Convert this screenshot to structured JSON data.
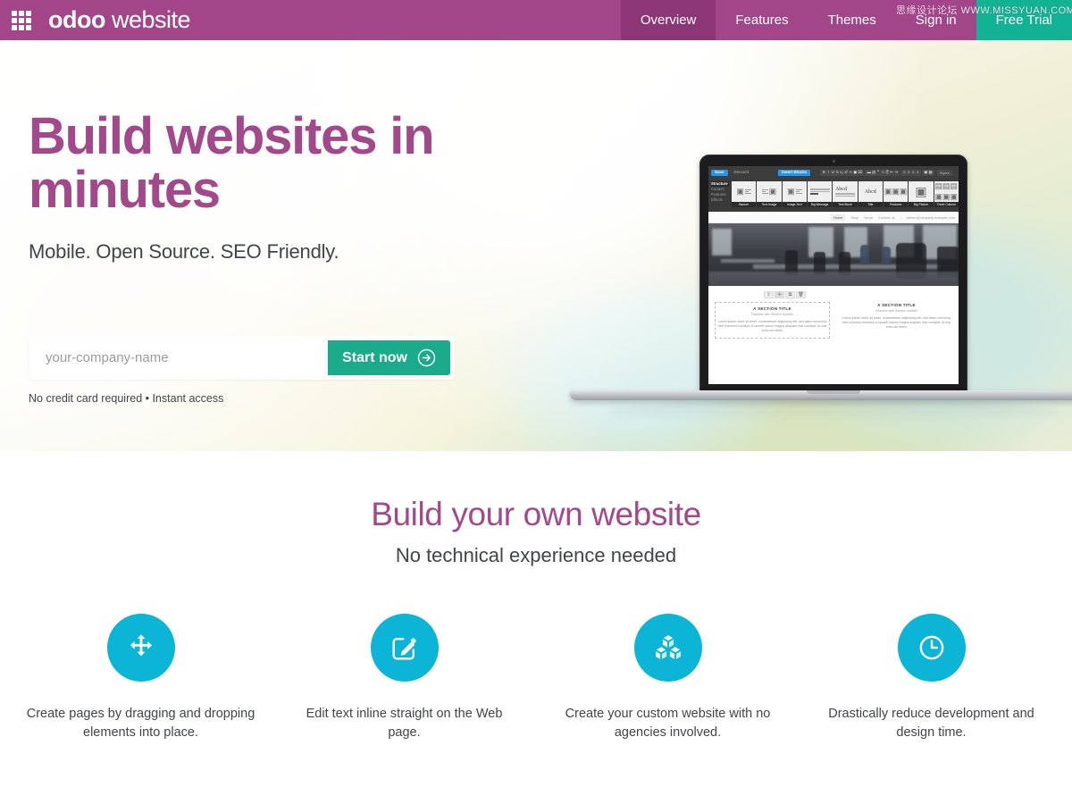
{
  "topbar": {
    "grid_icon": "apps-grid-icon",
    "brand_bold": "odoo",
    "brand_light": "website",
    "nav": [
      {
        "label": "Overview",
        "active": true
      },
      {
        "label": "Features",
        "active": false
      },
      {
        "label": "Themes",
        "active": false
      },
      {
        "label": "Sign in",
        "active": false
      }
    ],
    "trial_label": "Free Trial",
    "accent_purple": "#a24689",
    "accent_purple_dark": "#8d3675",
    "accent_teal": "#12b394"
  },
  "watermark": {
    "line1": "思缘设计论坛",
    "line2": "WWW.MISSYUAN.COM"
  },
  "hero": {
    "headline": "Build websites in minutes",
    "subheadline": "Mobile. Open Source. SEO Friendly.",
    "input_placeholder": "your-company-name",
    "input_value": "",
    "cta_label": "Start now",
    "cta_icon": "arrow-right-circle-icon",
    "fine_print": "No credit card required • Instant access",
    "heading_color": "#a2498c",
    "cta_color": "#1aab8a"
  },
  "laptop": {
    "editor": {
      "save_label": "Save",
      "discard_label": "Discard",
      "insert_blocks_label": "Insert Blocks",
      "toolbar_groups": [
        [
          "B",
          "I",
          "U",
          "S",
          "x₂",
          "x²",
          "A",
          "◼",
          "⌧"
        ],
        [
          "▬",
          "▤",
          "❞",
          "⁞≡",
          "⎘",
          "⇤",
          "⇥"
        ],
        [
          "≡",
          "≡",
          "≡",
          "≡"
        ],
        [
          "▣",
          "▦"
        ]
      ],
      "style_label": "Styles",
      "sidebar": [
        "Structure",
        "Content",
        "Features",
        "Effects"
      ],
      "blocks": [
        {
          "label": "Banner",
          "thumb": "camera-list-icon"
        },
        {
          "label": "Text-Image",
          "thumb": "list-camera-icon"
        },
        {
          "label": "Image-Text",
          "thumb": "camera-list-icon"
        },
        {
          "label": "Big Message",
          "thumb": "document-icon"
        },
        {
          "label": "Text Block",
          "thumb": "abcd-text-icon"
        },
        {
          "label": "Title",
          "thumb": "abcd-icon"
        },
        {
          "label": "Features",
          "thumb": "three-camera-icon"
        },
        {
          "label": "Big Picture",
          "thumb": "big-camera-icon"
        },
        {
          "label": "Three Column",
          "thumb": "three-column-icon"
        }
      ],
      "snippet_tools": [
        "⇧",
        "✛",
        "⧉",
        "🗑"
      ]
    },
    "site": {
      "nav": [
        "Home",
        "Shop",
        "News",
        "Contact us"
      ],
      "account": "admin@company.example.com",
      "columns": [
        {
          "title": "A SECTION TITLE",
          "subtitle": "Resume with Section Subtitle",
          "body": "Lorem ipsum dolor sit amet, consectetuer adipiscing elit, sed diam nonummy nibh euismod tincidunt ut laoreet dolore magna aliquam erat volutpat. Ut wisi enim ad minim"
        },
        {
          "title": "A SECTION TITLE",
          "subtitle": "Resume with Section Subtitle",
          "body": "Lorem ipsum dolor sit amet, consectetuer adipiscing elit, sed diam nonummy nibh euismod tincidunt ut laoreet dolore magna aliquam erat volutpat. Ut wisi enim ad minim"
        }
      ]
    }
  },
  "features": {
    "title": "Build your own website",
    "tagline": "No technical experience needed",
    "icon_color": "#0cb4d6",
    "items": [
      {
        "icon": "move-arrows-icon",
        "text": "Create pages by dragging and dropping elements into place."
      },
      {
        "icon": "edit-pencil-icon",
        "text": "Edit text inline straight on the Web page."
      },
      {
        "icon": "cubes-icon",
        "text": "Create your custom website with no agencies involved."
      },
      {
        "icon": "clock-icon",
        "text": "Drastically reduce development and design time."
      }
    ]
  }
}
